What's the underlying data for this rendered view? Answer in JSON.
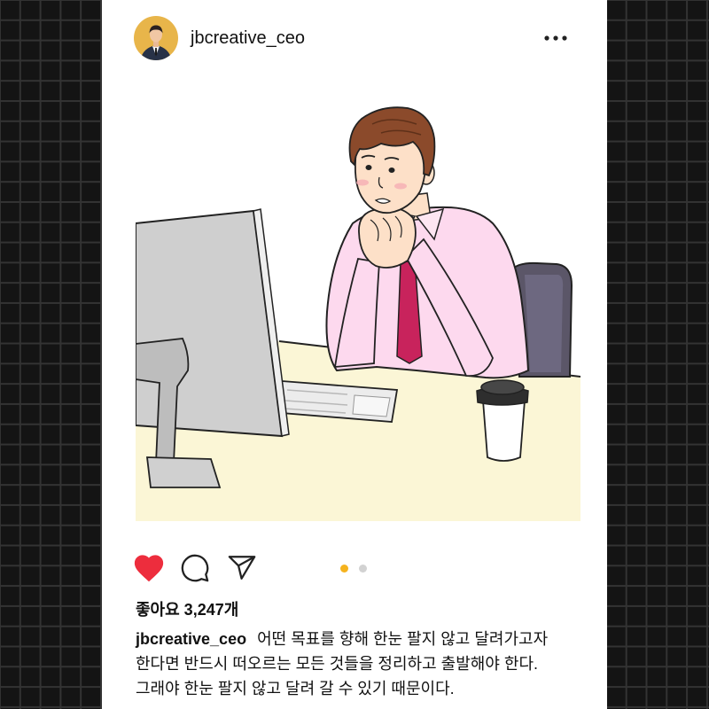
{
  "header": {
    "username": "jbcreative_ceo",
    "avatar_icon": "profile-photo",
    "more_icon": "more-horizontal-icon"
  },
  "actions": {
    "liked": true,
    "like_icon": "heart-icon",
    "comment_icon": "comment-icon",
    "share_icon": "send-icon"
  },
  "carousel": {
    "count": 2,
    "active_index": 0
  },
  "likes": {
    "label": "좋아요 3,247개"
  },
  "caption": {
    "username": "jbcreative_ceo",
    "lines": [
      "어떤 목표를 향해 한눈 팔지 않고 달려가고자",
      "한다면 반드시 떠오르는 모든 것들을 정리하고 출발해야 한다.",
      "그래야 한눈 팔지 않고 달려 갈 수 있기 때문이다."
    ]
  },
  "colors": {
    "page_bg": "#141414",
    "grid_line": "#333333",
    "card_bg": "#ffffff",
    "text": "#111111",
    "like": "#ed2d3d",
    "dot_active": "#f5b31e",
    "dot_inactive": "#d2d2d2",
    "avatar_bg": "#e8b54a"
  }
}
